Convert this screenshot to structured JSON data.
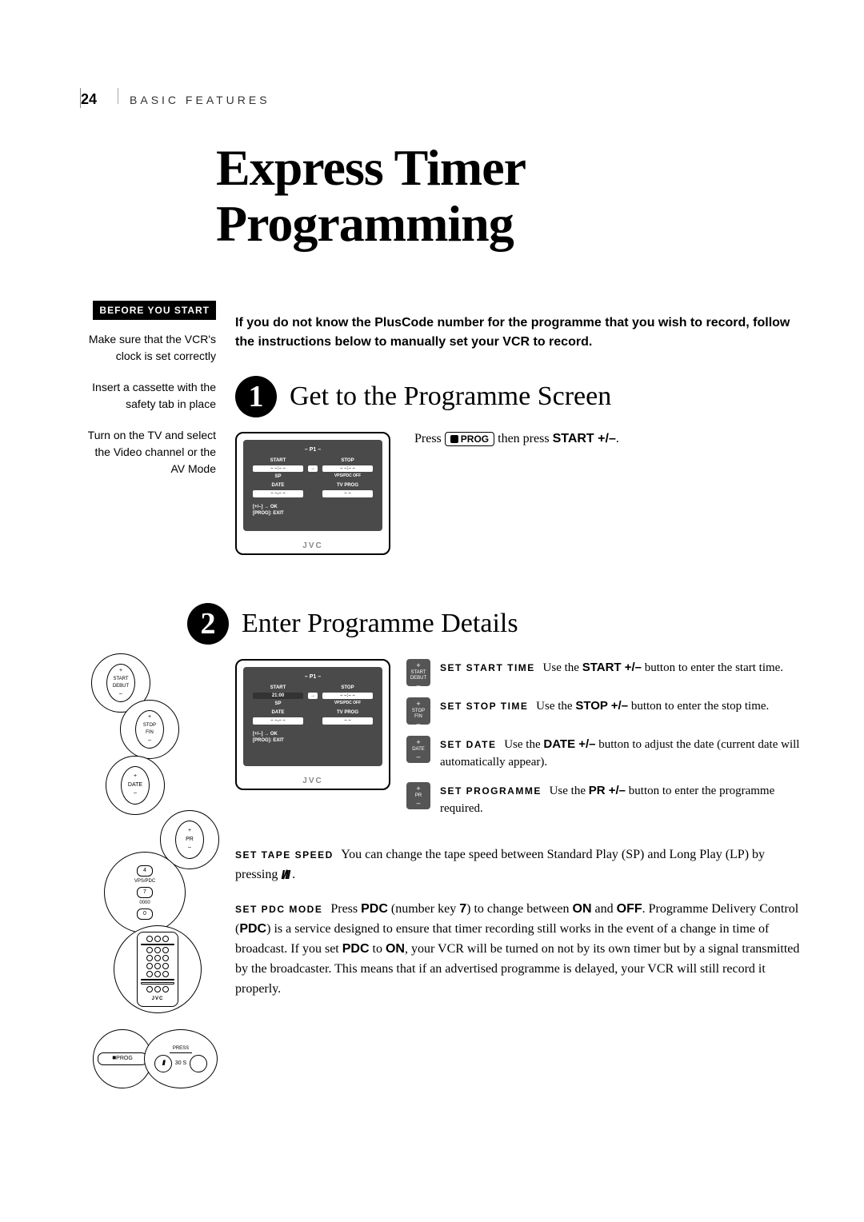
{
  "page_number": "24",
  "section": "BASIC FEATURES",
  "title": "Express Timer Programming",
  "before_badge": "BEFORE YOU START",
  "before_items": [
    "Make sure that the VCR's clock is set correctly",
    "Insert a cassette with the safety tab in place",
    "Turn on the TV and select the Video channel or the AV Mode"
  ],
  "lead": "If you do not know the PlusCode number for the programme that you wish to record, follow the instructions below to manually set your VCR to record.",
  "step1": {
    "num": "1",
    "title": "Get to the Programme Screen",
    "press1": "Press ",
    "prog_label": "PROG",
    "press2": " then press ",
    "start_label": "START +/–",
    "press3": "."
  },
  "osd_common": {
    "title": "– P1 –",
    "start": "START",
    "stop": "STOP",
    "arrow": "→",
    "dashes": "– –:– –",
    "sp": "SP",
    "vps": "VPS/PDC OFF",
    "date": "DATE",
    "tvprog": "TV PROG",
    "datev": "– –.– –",
    "progv": "– –",
    "foot1": "[+/–] → OK",
    "foot2": "[PROG]: EXIT",
    "brand": "JVC",
    "start_filled": "21:00"
  },
  "step2": {
    "num": "2",
    "title": "Enter Programme Details",
    "items": [
      {
        "btn": "START\nDEBUT",
        "runin": "SET START TIME",
        "body1": "  Use the  ",
        "label": "START +/–",
        "body2": " button to enter the start time."
      },
      {
        "btn": "STOP\nFIN",
        "runin": "SET STOP TIME",
        "body1": "  Use the ",
        "label": "STOP +/–",
        "body2": " button to enter the stop time."
      },
      {
        "btn": "DATE",
        "runin": "SET DATE",
        "body1": "  Use the ",
        "label": "DATE +/–",
        "body2": " button to adjust the date (current date will automatically appear)."
      },
      {
        "btn": "PR",
        "runin": "SET PROGRAMME",
        "body1": "  Use the ",
        "label": "PR +/–",
        "body2": " button to enter the programme required."
      }
    ],
    "tape": {
      "runin": "SET TAPE SPEED",
      "body": "  You can change the tape speed between Standard Play (SP) and Long Play (LP) by pressing ",
      "after": " ."
    },
    "pdc": {
      "runin": "SET PDC MODE",
      "p1": "  Press ",
      "pdc": "PDC",
      "p2": " (number key ",
      "seven": "7",
      "p3": ") to change between ",
      "on": "ON",
      "p4": " and ",
      "off": "OFF",
      "p5": ". Programme Delivery Control (",
      "p6": ") is a service designed to ensure that timer recording still works in the event of a change in time of broadcast. If you set ",
      "p7": " to ",
      "p8": ", your VCR will be turned on not by its own timer but by a signal transmitted by the broadcaster. This means that if an advertised programme is delayed, your VCR will still record it properly."
    }
  },
  "illus": {
    "start": "START\nDEBUT",
    "stop": "STOP\nFIN",
    "date": "DATE",
    "pr": "PR",
    "k4": "4",
    "k7": "7",
    "k0": "0",
    "vps": "VPS/PDC",
    "oooo": "0000",
    "prog": "PROG",
    "press": "PRESS",
    "thirty": "30 S",
    "brand": "JVC"
  }
}
